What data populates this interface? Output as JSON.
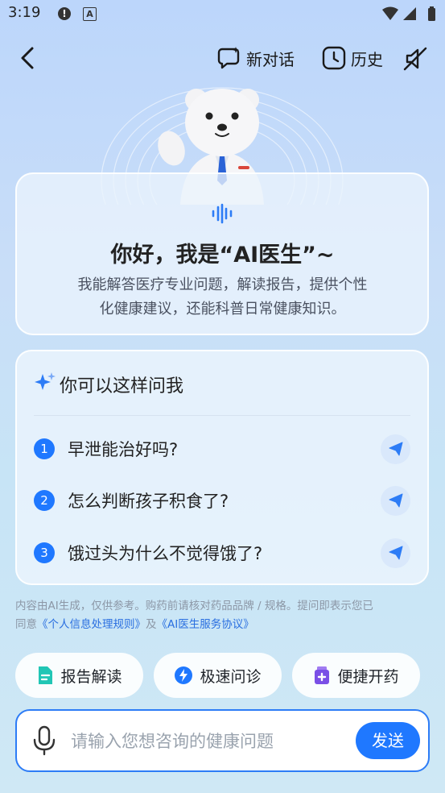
{
  "status_bar": {
    "time": "3:19"
  },
  "header": {
    "new_chat_label": "新对话",
    "history_label": "历史"
  },
  "intro": {
    "greeting": "你好，我是“AI医生”~",
    "description_line1": "我能解答医疗专业问题，解读报告，提供个性",
    "description_line2": "化健康建议，还能科普日常健康知识。"
  },
  "suggestions": {
    "title": "你可以这样问我",
    "items": [
      {
        "num": "1",
        "text": "早泄能治好吗?"
      },
      {
        "num": "2",
        "text": "怎么判断孩子积食了?"
      },
      {
        "num": "3",
        "text": "饿过头为什么不觉得饿了?"
      }
    ]
  },
  "disclaimer": {
    "line1": "内容由AI生成，仅供参考。购药前请核对药品品牌 / 规格。提问即表示您已",
    "prefix": "同意",
    "link1": "《个人信息处理规则》",
    "joiner": "及",
    "link2": "《AI医生服务协议》"
  },
  "quick_actions": [
    {
      "label": "报告解读",
      "icon": "report-icon"
    },
    {
      "label": "极速问诊",
      "icon": "lightning-icon"
    },
    {
      "label": "便捷开药",
      "icon": "medicine-icon"
    }
  ],
  "input": {
    "placeholder": "请输入您想咨询的健康问题",
    "send_label": "发送"
  },
  "colors": {
    "accent": "#1f78ff",
    "background": "#c9def8"
  }
}
